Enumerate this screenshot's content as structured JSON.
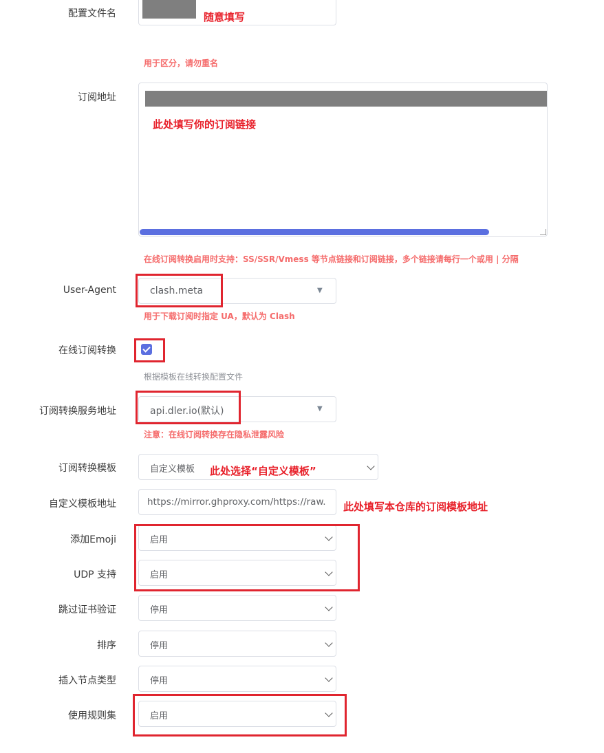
{
  "config_name": {
    "label": "配置文件名",
    "annotation": "随意填写",
    "hint": "用于区分，请勿重名"
  },
  "subscription_url": {
    "label": "订阅地址",
    "annotation": "此处填写你的订阅链接",
    "hint": "在线订阅转换启用时支持：SS/SSR/Vmess 等节点链接和订阅链接，多个链接请每行一个或用 | 分隔"
  },
  "user_agent": {
    "label": "User-Agent",
    "value": "clash.meta",
    "hint": "用于下载订阅时指定 UA，默认为 Clash"
  },
  "online_convert": {
    "label": "在线订阅转换",
    "checked": true,
    "hint": "根据模板在线转换配置文件"
  },
  "convert_server": {
    "label": "订阅转换服务地址",
    "value": "api.dler.io(默认)",
    "hint": "注意：在线订阅转换存在隐私泄露风险"
  },
  "convert_template": {
    "label": "订阅转换模板",
    "value": "自定义模板",
    "annotation": "此处选择“自定义模板”"
  },
  "custom_template_url": {
    "label": "自定义模板地址",
    "value": "https://mirror.ghproxy.com/https://raw.",
    "annotation": "此处填写本仓库的订阅模板地址"
  },
  "add_emoji": {
    "label": "添加Emoji",
    "value": "启用"
  },
  "udp": {
    "label": "UDP 支持",
    "value": "启用"
  },
  "skip_cert": {
    "label": "跳过证书验证",
    "value": "停用"
  },
  "sort": {
    "label": "排序",
    "value": "停用"
  },
  "insert_node_type": {
    "label": "插入节点类型",
    "value": "停用"
  },
  "use_ruleset": {
    "label": "使用规则集",
    "value": "启用"
  },
  "colors": {
    "accent": "#5b6fe0",
    "hint_red": "#f56c6c",
    "annotation_red": "#e8212b"
  }
}
